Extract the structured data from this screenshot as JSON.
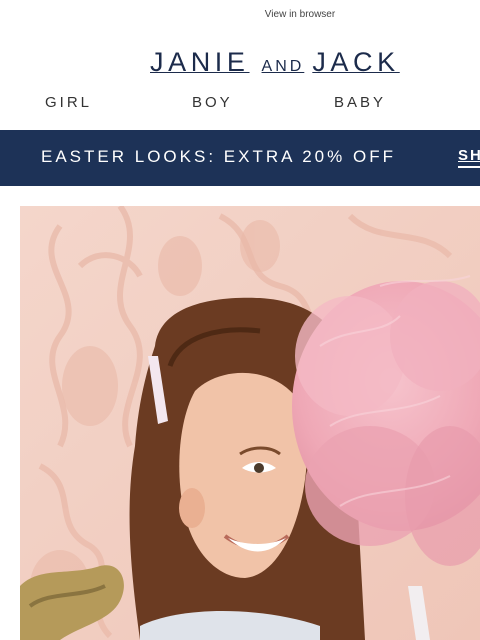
{
  "header": {
    "view_in_browser": "View in browser",
    "logo": {
      "word1": "JANIE",
      "word2": "AND",
      "word3": "JACK"
    }
  },
  "nav": {
    "items": [
      "GIRL",
      "BOY",
      "BABY"
    ]
  },
  "banner": {
    "promo_text": "EASTER LOOKS: EXTRA 20% OFF",
    "cta": "SH",
    "background_color": "#1d3257"
  },
  "colors": {
    "brand_navy": "#1c2b4b",
    "banner_navy": "#1d3257",
    "hero_pink": "#f2d0c4"
  }
}
